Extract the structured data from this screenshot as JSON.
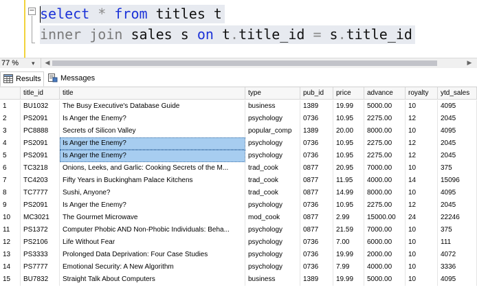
{
  "editor": {
    "line1": {
      "kw1": "select",
      "op": "*",
      "kw2": "from",
      "table": "titles",
      "alias": "t"
    },
    "line2": {
      "kw1": "inner",
      "kw2": "join",
      "table": "sales",
      "alias": "s",
      "kw3": "on",
      "left": "t",
      "dot1": ".",
      "col1": "title_id",
      "eq": "=",
      "right": "s",
      "dot2": ".",
      "col2": "title_id"
    }
  },
  "zoom": {
    "value": "77 %",
    "arrow": "▾"
  },
  "tabs": {
    "results": "Results",
    "messages": "Messages"
  },
  "grid": {
    "columns": [
      "title_id",
      "title",
      "type",
      "pub_id",
      "price",
      "advance",
      "royalty",
      "ytd_sales"
    ],
    "rows": [
      {
        "n": "1",
        "title_id": "BU1032",
        "title": "The Busy Executive's Database Guide",
        "type": "business",
        "pub_id": "1389",
        "price": "19.99",
        "advance": "5000.00",
        "royalty": "10",
        "ytd_sales": "4095"
      },
      {
        "n": "2",
        "title_id": "PS2091",
        "title": "Is Anger the Enemy?",
        "type": "psychology",
        "pub_id": "0736",
        "price": "10.95",
        "advance": "2275.00",
        "royalty": "12",
        "ytd_sales": "2045"
      },
      {
        "n": "3",
        "title_id": "PC8888",
        "title": "Secrets of Silicon Valley",
        "type": "popular_comp",
        "pub_id": "1389",
        "price": "20.00",
        "advance": "8000.00",
        "royalty": "10",
        "ytd_sales": "4095"
      },
      {
        "n": "4",
        "title_id": "PS2091",
        "title": "Is Anger the Enemy?",
        "type": "psychology",
        "pub_id": "0736",
        "price": "10.95",
        "advance": "2275.00",
        "royalty": "12",
        "ytd_sales": "2045"
      },
      {
        "n": "5",
        "title_id": "PS2091",
        "title": "Is Anger the Enemy?",
        "type": "psychology",
        "pub_id": "0736",
        "price": "10.95",
        "advance": "2275.00",
        "royalty": "12",
        "ytd_sales": "2045"
      },
      {
        "n": "6",
        "title_id": "TC3218",
        "title": "Onions, Leeks, and Garlic: Cooking Secrets of the M...",
        "type": "trad_cook",
        "pub_id": "0877",
        "price": "20.95",
        "advance": "7000.00",
        "royalty": "10",
        "ytd_sales": "375"
      },
      {
        "n": "7",
        "title_id": "TC4203",
        "title": "Fifty Years in Buckingham Palace Kitchens",
        "type": "trad_cook",
        "pub_id": "0877",
        "price": "11.95",
        "advance": "4000.00",
        "royalty": "14",
        "ytd_sales": "15096"
      },
      {
        "n": "8",
        "title_id": "TC7777",
        "title": "Sushi, Anyone?",
        "type": "trad_cook",
        "pub_id": "0877",
        "price": "14.99",
        "advance": "8000.00",
        "royalty": "10",
        "ytd_sales": "4095"
      },
      {
        "n": "9",
        "title_id": "PS2091",
        "title": "Is Anger the Enemy?",
        "type": "psychology",
        "pub_id": "0736",
        "price": "10.95",
        "advance": "2275.00",
        "royalty": "12",
        "ytd_sales": "2045"
      },
      {
        "n": "10",
        "title_id": "MC3021",
        "title": "The Gourmet Microwave",
        "type": "mod_cook",
        "pub_id": "0877",
        "price": "2.99",
        "advance": "15000.00",
        "royalty": "24",
        "ytd_sales": "22246"
      },
      {
        "n": "11",
        "title_id": "PS1372",
        "title": "Computer Phobic AND Non-Phobic Individuals: Beha...",
        "type": "psychology",
        "pub_id": "0877",
        "price": "21.59",
        "advance": "7000.00",
        "royalty": "10",
        "ytd_sales": "375"
      },
      {
        "n": "12",
        "title_id": "PS2106",
        "title": "Life Without Fear",
        "type": "psychology",
        "pub_id": "0736",
        "price": "7.00",
        "advance": "6000.00",
        "royalty": "10",
        "ytd_sales": "111"
      },
      {
        "n": "13",
        "title_id": "PS3333",
        "title": "Prolonged Data Deprivation: Four Case Studies",
        "type": "psychology",
        "pub_id": "0736",
        "price": "19.99",
        "advance": "2000.00",
        "royalty": "10",
        "ytd_sales": "4072"
      },
      {
        "n": "14",
        "title_id": "PS7777",
        "title": "Emotional Security: A New Algorithm",
        "type": "psychology",
        "pub_id": "0736",
        "price": "7.99",
        "advance": "4000.00",
        "royalty": "10",
        "ytd_sales": "3336"
      },
      {
        "n": "15",
        "title_id": "BU7832",
        "title": "Straight Talk About Computers",
        "type": "business",
        "pub_id": "1389",
        "price": "19.99",
        "advance": "5000.00",
        "royalty": "10",
        "ytd_sales": "4095"
      }
    ],
    "selected_rows": [
      4,
      5
    ],
    "selected_column": "title",
    "selection_color": "#a7cdf0"
  },
  "colors": {
    "keyword": "#1b32d8",
    "keyword_dim": "#7a7a7a",
    "gutter_marker": "#f2d33a"
  }
}
